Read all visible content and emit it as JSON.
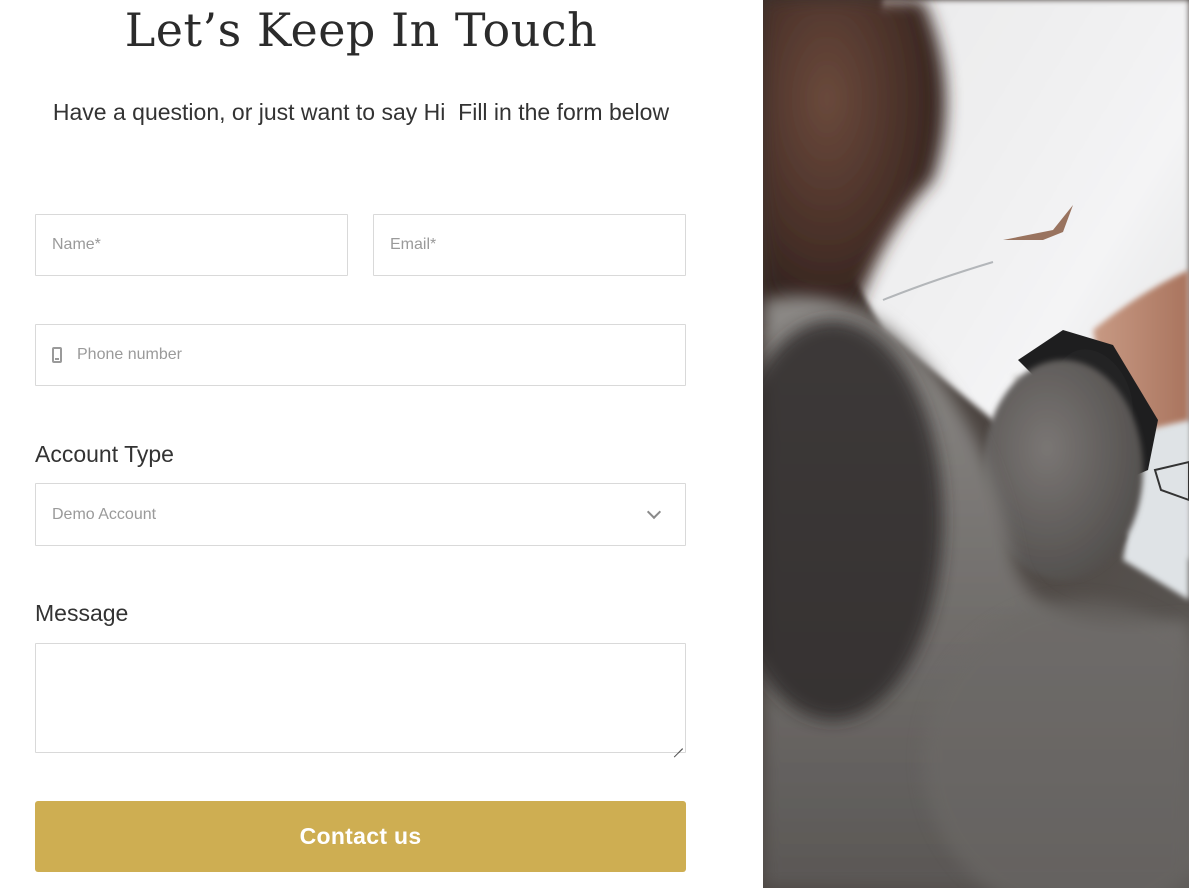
{
  "header": {
    "title": "Let’s Keep In Touch",
    "subtitle": "Have a question, or just want to say Hi  Fill in the form below"
  },
  "form": {
    "name": {
      "placeholder": "Name*",
      "value": ""
    },
    "email": {
      "placeholder": "Email*",
      "value": ""
    },
    "phone": {
      "placeholder": "Phone number",
      "value": "",
      "icon": "mobile-phone-icon"
    },
    "account_type": {
      "label": "Account Type",
      "selected": "Demo Account",
      "icon": "chevron-down-icon"
    },
    "message": {
      "label": "Message",
      "value": ""
    },
    "submit_label": "Contact us"
  },
  "colors": {
    "accent": "#ceae52",
    "text": "#333333",
    "placeholder": "#9a9a9a",
    "border": "#d9d9d9"
  }
}
